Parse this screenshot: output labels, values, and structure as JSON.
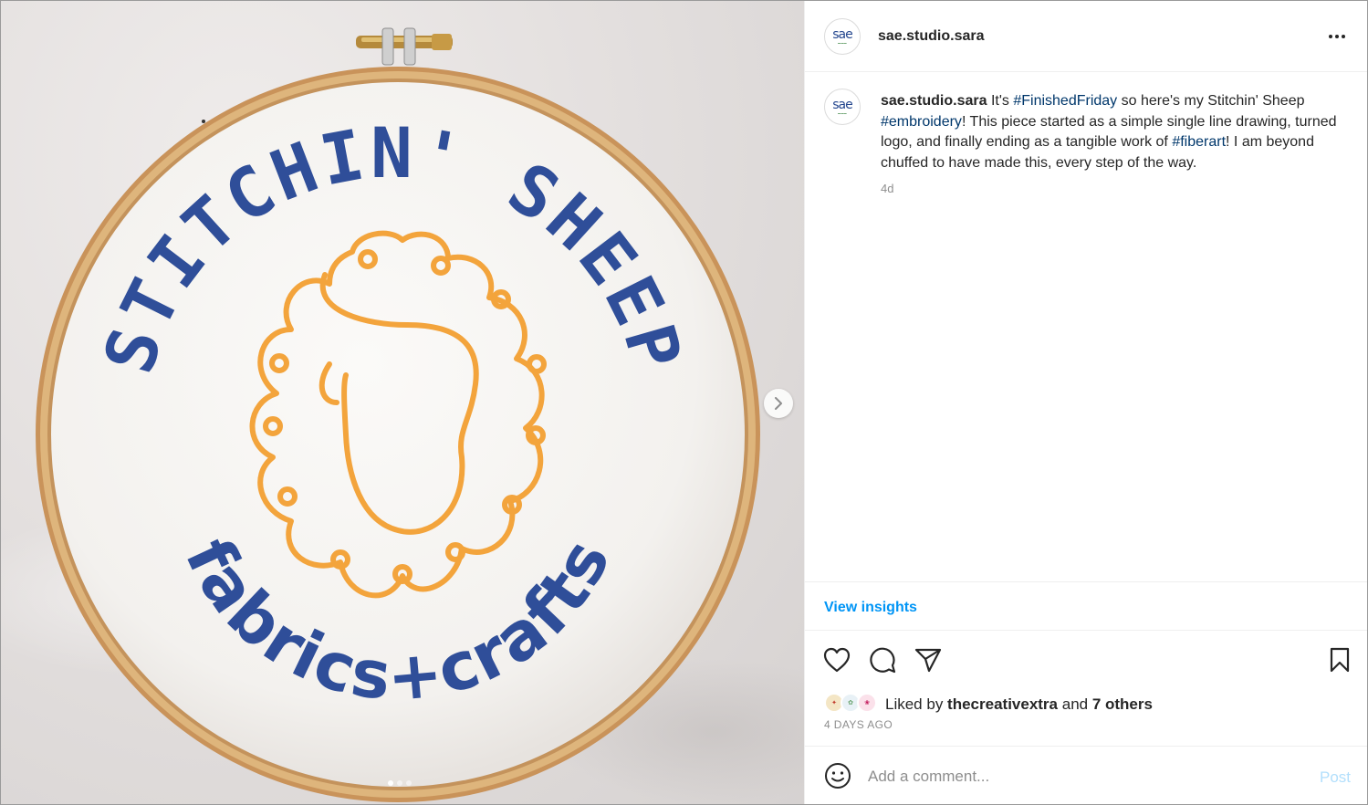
{
  "media": {
    "embroidery_text_top": "STITCHIN' SHEEP",
    "embroidery_text_bottom": "fabrics+crafts",
    "next_icon": "chevron-right-icon",
    "carousel_count": 3,
    "carousel_active": 1,
    "colors": {
      "thread_blue": "#2f4e99",
      "thread_orange": "#f3a43c",
      "hoop_wood": "#d7ad73",
      "fabric": "#f7f6f4"
    }
  },
  "header": {
    "avatar_logo": "sae",
    "username": "sae.studio.sara",
    "more_icon": "more-horizontal-icon"
  },
  "caption": {
    "avatar_logo": "sae",
    "username": "sae.studio.sara",
    "part1": " It's ",
    "tag1": "#FinishedFriday",
    "part2": " so here's my Stitchin' Sheep ",
    "tag2": "#embroidery",
    "part3": "! This piece started as a simple single line drawing, turned logo, and finally ending as a tangible work of ",
    "tag3": "#fiberart",
    "part4": "! I am beyond chuffed to have made this, every step of the way.",
    "time": "4d"
  },
  "insights": {
    "label": "View insights",
    "color": "#0095f6"
  },
  "actions": {
    "like_icon": "heart-icon",
    "comment_icon": "comment-bubble-icon",
    "share_icon": "paper-plane-icon",
    "save_icon": "bookmark-icon"
  },
  "likes": {
    "prefix": "Liked by ",
    "user": "thecreativextra",
    "middle": " and ",
    "others": "7 others",
    "date": "4 DAYS AGO"
  },
  "comment": {
    "emoji_icon": "smiley-face-icon",
    "placeholder": "Add a comment...",
    "post_label": "Post"
  }
}
